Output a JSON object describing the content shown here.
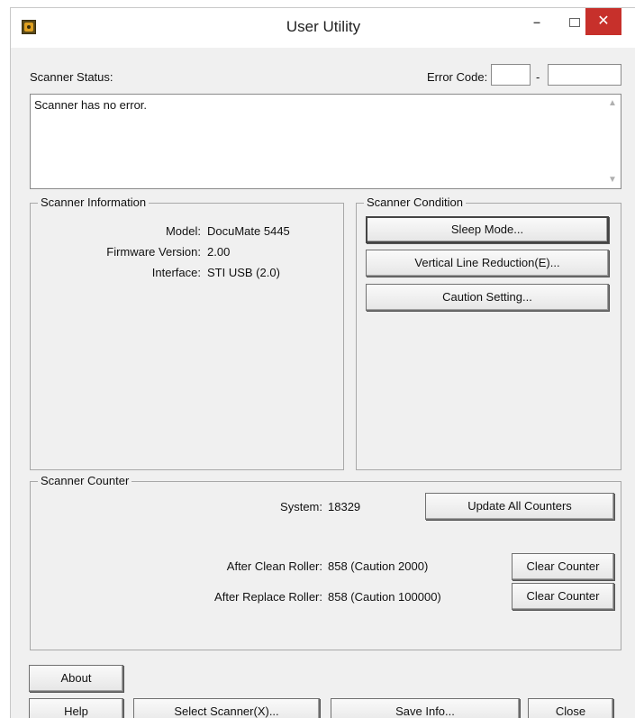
{
  "window": {
    "title": "User Utility",
    "minimize_glyph": "–",
    "close_glyph": "✕"
  },
  "status": {
    "label": "Scanner Status:",
    "error_code_label": "Error Code:",
    "error_code_1": "",
    "error_code_sep": "-",
    "error_code_2": "",
    "message": "Scanner has no error."
  },
  "info": {
    "title": "Scanner Information",
    "model_label": "Model:",
    "model_value": "DocuMate 5445",
    "firmware_label": "Firmware Version:",
    "firmware_value": "2.00",
    "interface_label": "Interface:",
    "interface_value": "STI USB (2.0)"
  },
  "condition": {
    "title": "Scanner Condition",
    "sleep_mode": "Sleep Mode...",
    "vertical_line": "Vertical Line Reduction(E)...",
    "caution": "Caution Setting..."
  },
  "counter": {
    "title": "Scanner Counter",
    "system_label": "System:",
    "system_value": "18329",
    "update_all": "Update All Counters",
    "clean_label": "After Clean Roller:",
    "clean_value": "858 (Caution 2000)",
    "replace_label": "After Replace Roller:",
    "replace_value": "858 (Caution 100000)",
    "clear_1": "Clear Counter",
    "clear_2": "Clear Counter"
  },
  "footer": {
    "about": "About",
    "help": "Help",
    "select_scanner": "Select Scanner(X)...",
    "save_info": "Save Info...",
    "close": "Close"
  }
}
